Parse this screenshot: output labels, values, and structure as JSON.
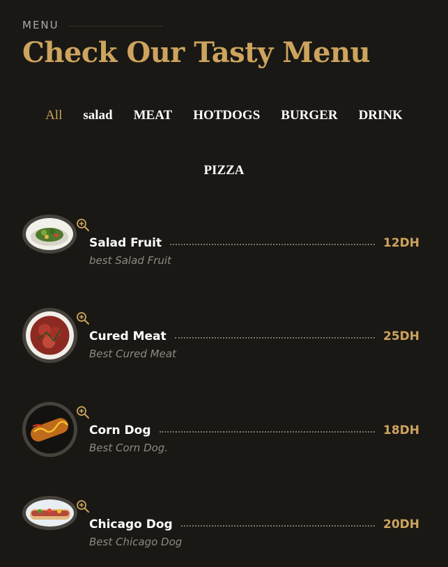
{
  "section": {
    "kicker": "MENU",
    "title": "Check Our Tasty Menu"
  },
  "filters": [
    {
      "label": "All",
      "active": true
    },
    {
      "label": "salad"
    },
    {
      "label": "MEAT"
    },
    {
      "label": "HOTDOGS"
    },
    {
      "label": "BURGER"
    },
    {
      "label": "DRINK"
    },
    {
      "label": "PIZZA"
    }
  ],
  "items": [
    {
      "name": "Salad Fruit",
      "price": "12DH",
      "description": "best Salad Fruit",
      "image": "salad-photo"
    },
    {
      "name": "Cured Meat",
      "price": "25DH",
      "description": "Best Cured Meat",
      "image": "meat-photo"
    },
    {
      "name": "Corn Dog",
      "price": "18DH",
      "description": "Best Corn Dog.",
      "image": "corndog-photo"
    },
    {
      "name": "Chicago Dog",
      "price": "20DH",
      "description": "Best Chicago Dog",
      "image": "hotdog-photo"
    }
  ],
  "icons": {
    "zoom": "zoom-in-icon"
  },
  "colors": {
    "background": "#1a1814",
    "accent": "#cda45e",
    "text": "#ffffff",
    "muted": "#8e8a83"
  }
}
